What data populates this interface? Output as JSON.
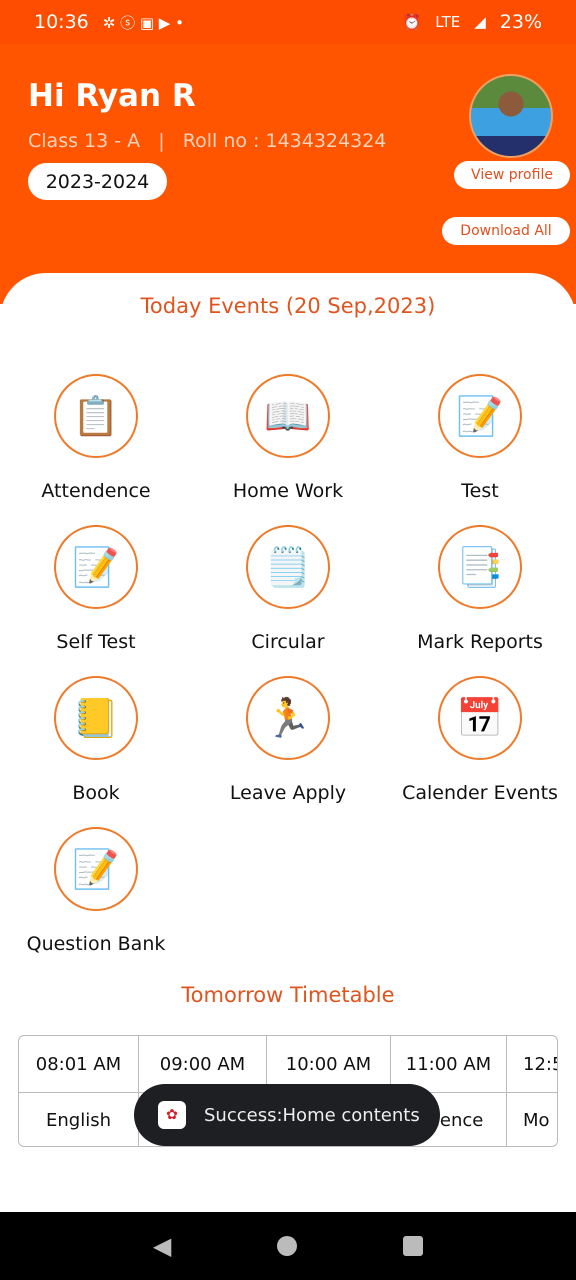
{
  "status_bar": {
    "time": "10:36",
    "battery": "23%",
    "network": "LTE"
  },
  "header": {
    "greeting": "Hi Ryan R",
    "class_info": "Class 13 - A   |   Roll no : 1434324324",
    "year": "2023-2024",
    "view_profile": "View profile",
    "download_all": "Download All"
  },
  "events_title": "Today Events (20 Sep,2023)",
  "tiles": [
    {
      "label": "Attendence",
      "icon": "📋"
    },
    {
      "label": "Home Work",
      "icon": "📖"
    },
    {
      "label": "Test",
      "icon": "📝"
    },
    {
      "label": "Self Test",
      "icon": "📝"
    },
    {
      "label": "Circular",
      "icon": "🗒️"
    },
    {
      "label": "Mark Reports",
      "icon": "📑"
    },
    {
      "label": "Book",
      "icon": "📒"
    },
    {
      "label": "Leave Apply",
      "icon": "🏃"
    },
    {
      "label": "Calender Events",
      "icon": "📅"
    },
    {
      "label": "Question Bank",
      "icon": "📝"
    }
  ],
  "timetable": {
    "title": "Tomorrow Timetable",
    "times": [
      "08:01 AM",
      "09:00 AM",
      "10:00 AM",
      "11:00 AM",
      "12:5"
    ],
    "subjects": [
      "English",
      "",
      "",
      "Science",
      "Mo"
    ]
  },
  "toast": {
    "message": "Success:Home contents"
  },
  "colors": {
    "primary": "#FF5500",
    "accent": "#E0541E"
  }
}
